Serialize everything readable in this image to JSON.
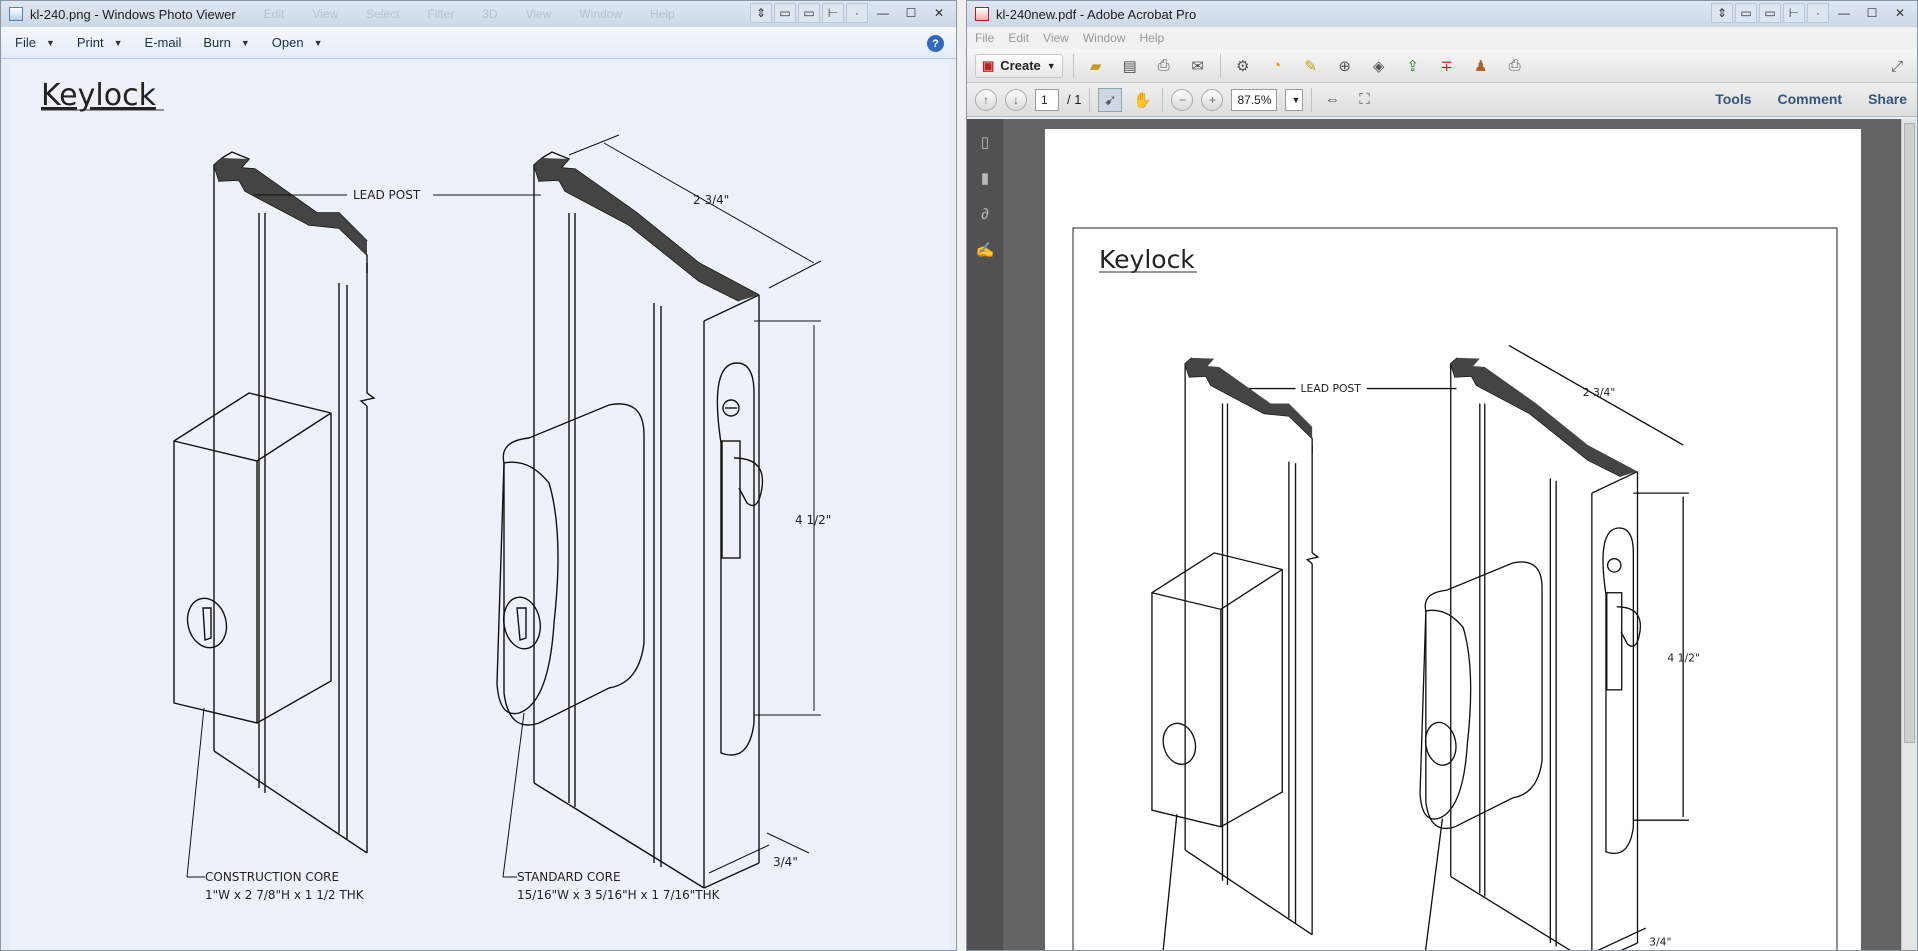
{
  "photo_viewer": {
    "title": "kl-240.png - Windows Photo Viewer",
    "ghost_menu": [
      "Edit",
      "View",
      "Select",
      "Filter",
      "3D",
      "View",
      "Window",
      "Help"
    ],
    "menu": [
      {
        "label": "File",
        "has_dropdown": true
      },
      {
        "label": "Print",
        "has_dropdown": true
      },
      {
        "label": "E-mail",
        "has_dropdown": false
      },
      {
        "label": "Burn",
        "has_dropdown": true
      },
      {
        "label": "Open",
        "has_dropdown": true
      }
    ],
    "help_icon": "?"
  },
  "acrobat": {
    "title": "kl-240new.pdf - Adobe Acrobat Pro",
    "menu": [
      "File",
      "Edit",
      "View",
      "Window",
      "Help"
    ],
    "create_label": "Create",
    "page_current": "1",
    "page_total": "/ 1",
    "zoom": "87.5%",
    "links": [
      "Tools",
      "Comment",
      "Share"
    ]
  },
  "drawing": {
    "title": "Keylock",
    "lead_post": "LEAD POST",
    "dim_width": "2 3/4\"",
    "dim_height": "4 1/2\"",
    "dim_depth": "3/4\"",
    "core1_name": "CONSTRUCTION CORE",
    "core1_spec": "1\"W x 2 7/8\"H x 1 1/2 THK",
    "core2_name": "STANDARD CORE",
    "core2_spec": "15/16\"W x 3 5/16\"H x 1 7/16\"THK"
  },
  "icons": [
    "close-icon",
    "maximize-icon",
    "minimize-icon",
    "help-icon",
    "printer-icon",
    "folder-icon",
    "save-icon",
    "email-icon",
    "gear-icon",
    "comment-icon",
    "hand-icon",
    "select-icon",
    "zoom-in-icon",
    "zoom-out-icon"
  ],
  "colors": {
    "pv_bg": "#edf2fa",
    "ac_page": "#ffffff",
    "ac_bg": "#636363",
    "link": "#35557d"
  }
}
